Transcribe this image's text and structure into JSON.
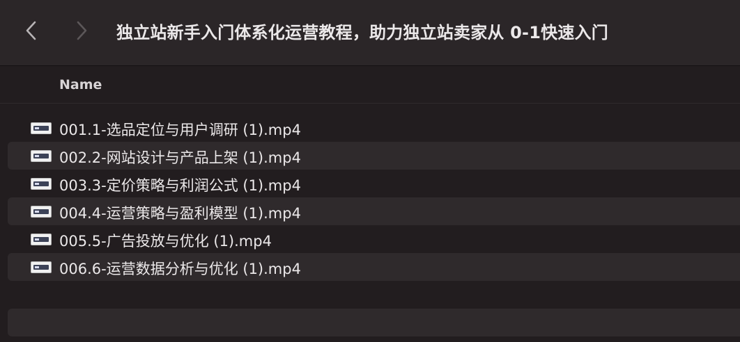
{
  "window": {
    "title": "独立站新手入门体系化运营教程，助力独立站卖家从 0-1快速入门"
  },
  "toolbar": {
    "back_icon": "chevron-left-icon",
    "forward_icon": "chevron-right-icon"
  },
  "columns": {
    "name": "Name"
  },
  "files": [
    {
      "name": "001.1-选品定位与用户调研  (1).mp4",
      "icon": "video-file-icon"
    },
    {
      "name": "002.2-网站设计与产品上架  (1).mp4",
      "icon": "video-file-icon"
    },
    {
      "name": "003.3-定价策略与利润公式  (1).mp4",
      "icon": "video-file-icon"
    },
    {
      "name": "004.4-运营策略与盈利模型  (1).mp4",
      "icon": "video-file-icon"
    },
    {
      "name": "005.5-广告投放与优化  (1).mp4",
      "icon": "video-file-icon"
    },
    {
      "name": "006.6-运营数据分析与优化  (1).mp4",
      "icon": "video-file-icon"
    }
  ],
  "colors": {
    "background": "#221d1f",
    "toolbar": "#2b2628",
    "stripe": "#2f2a2c",
    "text": "#ebe8e9"
  }
}
